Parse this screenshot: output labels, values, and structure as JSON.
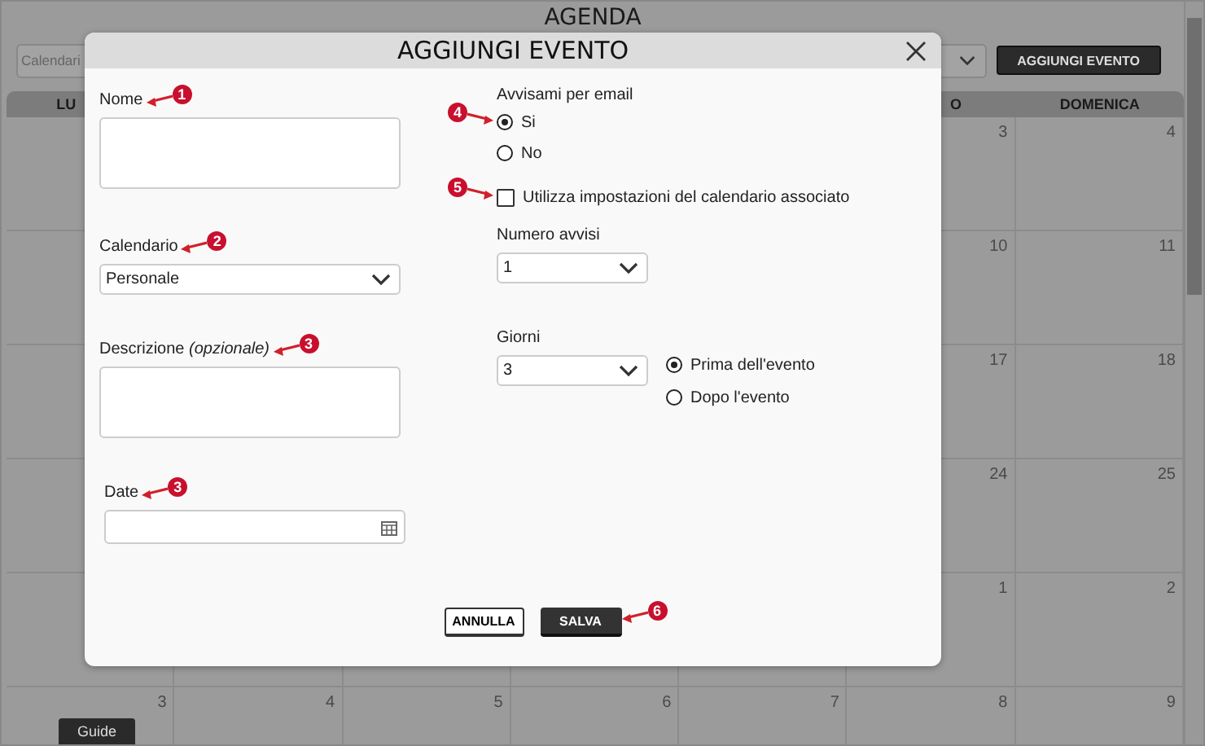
{
  "page": {
    "title": "AGENDA",
    "calendar_select": {
      "placeholder": "Calendari"
    },
    "add_button": "AGGIUNGI EVENTO",
    "guide_button": "Guide"
  },
  "calendar": {
    "headers": [
      "LU",
      "O",
      "DOMENICA"
    ],
    "weeks": [
      {
        "days": [
          "3",
          "4"
        ]
      },
      {
        "days": [
          "10",
          "11"
        ]
      },
      {
        "days": [
          "17",
          "18"
        ]
      },
      {
        "days": [
          "24",
          "25"
        ]
      },
      {
        "days": [
          "1",
          "2"
        ]
      },
      {
        "days": [
          "3",
          "4",
          "5",
          "6",
          "7",
          "8",
          "9"
        ]
      }
    ]
  },
  "dialog": {
    "title": "AGGIUNGI EVENTO",
    "name_field": {
      "label": "Nome",
      "callout": "1"
    },
    "calendar_field": {
      "label": "Calendario",
      "value": "Personale",
      "callout": "2"
    },
    "description_field": {
      "label": "Descrizione *(opzionale)*",
      "callout": "3"
    },
    "date_field": {
      "label": "Date",
      "callout": "3"
    },
    "email_alert": {
      "label": "Avvisami per email",
      "callout": "4",
      "options": [
        {
          "label": "Si",
          "selected": true
        },
        {
          "label": "No",
          "selected": false
        }
      ]
    },
    "use_calendar_settings": {
      "label": "Utilizza impostazioni del calendario associato",
      "checked": false,
      "callout": "5"
    },
    "alert_count": {
      "label": "Numero avvisi",
      "value": "1"
    },
    "days": {
      "label": "Giorni",
      "value": "3",
      "options": [
        {
          "label": "Prima dell'evento",
          "selected": true
        },
        {
          "label": "Dopo l'evento",
          "selected": false
        }
      ]
    },
    "cancel_button": "ANNULLA",
    "save_button": {
      "label": "SALVA",
      "callout": "6"
    }
  }
}
